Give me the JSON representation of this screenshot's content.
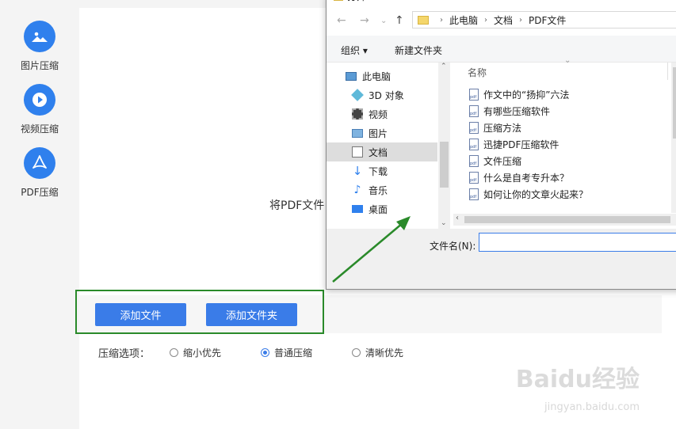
{
  "sidebar": {
    "items": [
      {
        "label": "图片压缩",
        "icon": "image-icon"
      },
      {
        "label": "视频压缩",
        "icon": "play-icon"
      },
      {
        "label": "PDF压缩",
        "icon": "pdf-icon"
      }
    ]
  },
  "main": {
    "drop_text": "将PDF文件",
    "add_file_button": "添加文件",
    "add_folder_button": "添加文件夹",
    "compress_options": {
      "title": "压缩选项：",
      "options": [
        "缩小优先",
        "普通压缩",
        "清晰优先"
      ],
      "selected": "普通压缩"
    }
  },
  "dialog": {
    "title": "打开",
    "breadcrumb": [
      "此电脑",
      "文档",
      "PDF文件"
    ],
    "toolbar": {
      "organize": "组织 ▾",
      "new_folder": "新建文件夹"
    },
    "nav_items": [
      {
        "label": "此电脑",
        "icon": "computer-icon"
      },
      {
        "label": "3D 对象",
        "icon": "cube-icon"
      },
      {
        "label": "视频",
        "icon": "film-icon"
      },
      {
        "label": "图片",
        "icon": "picture-icon"
      },
      {
        "label": "文档",
        "icon": "document-icon",
        "selected": true
      },
      {
        "label": "下载",
        "icon": "download-icon"
      },
      {
        "label": "音乐",
        "icon": "music-icon"
      },
      {
        "label": "桌面",
        "icon": "desktop-icon"
      }
    ],
    "column_header": "名称",
    "files": [
      "作文中的“扬抑”六法",
      "有哪些压缩软件",
      "压缩方法",
      "迅捷PDF压缩软件",
      "文件压缩",
      "什么是自考专升本？",
      "如何让你的文章火起来？"
    ],
    "filename_label": "文件名(N):",
    "filename_value": ""
  },
  "watermark": {
    "text": "Baidu经验",
    "sub": "jingyan.baidu.com"
  },
  "colors": {
    "accent": "#3a7ce8",
    "annotation": "#2a8a2a"
  }
}
